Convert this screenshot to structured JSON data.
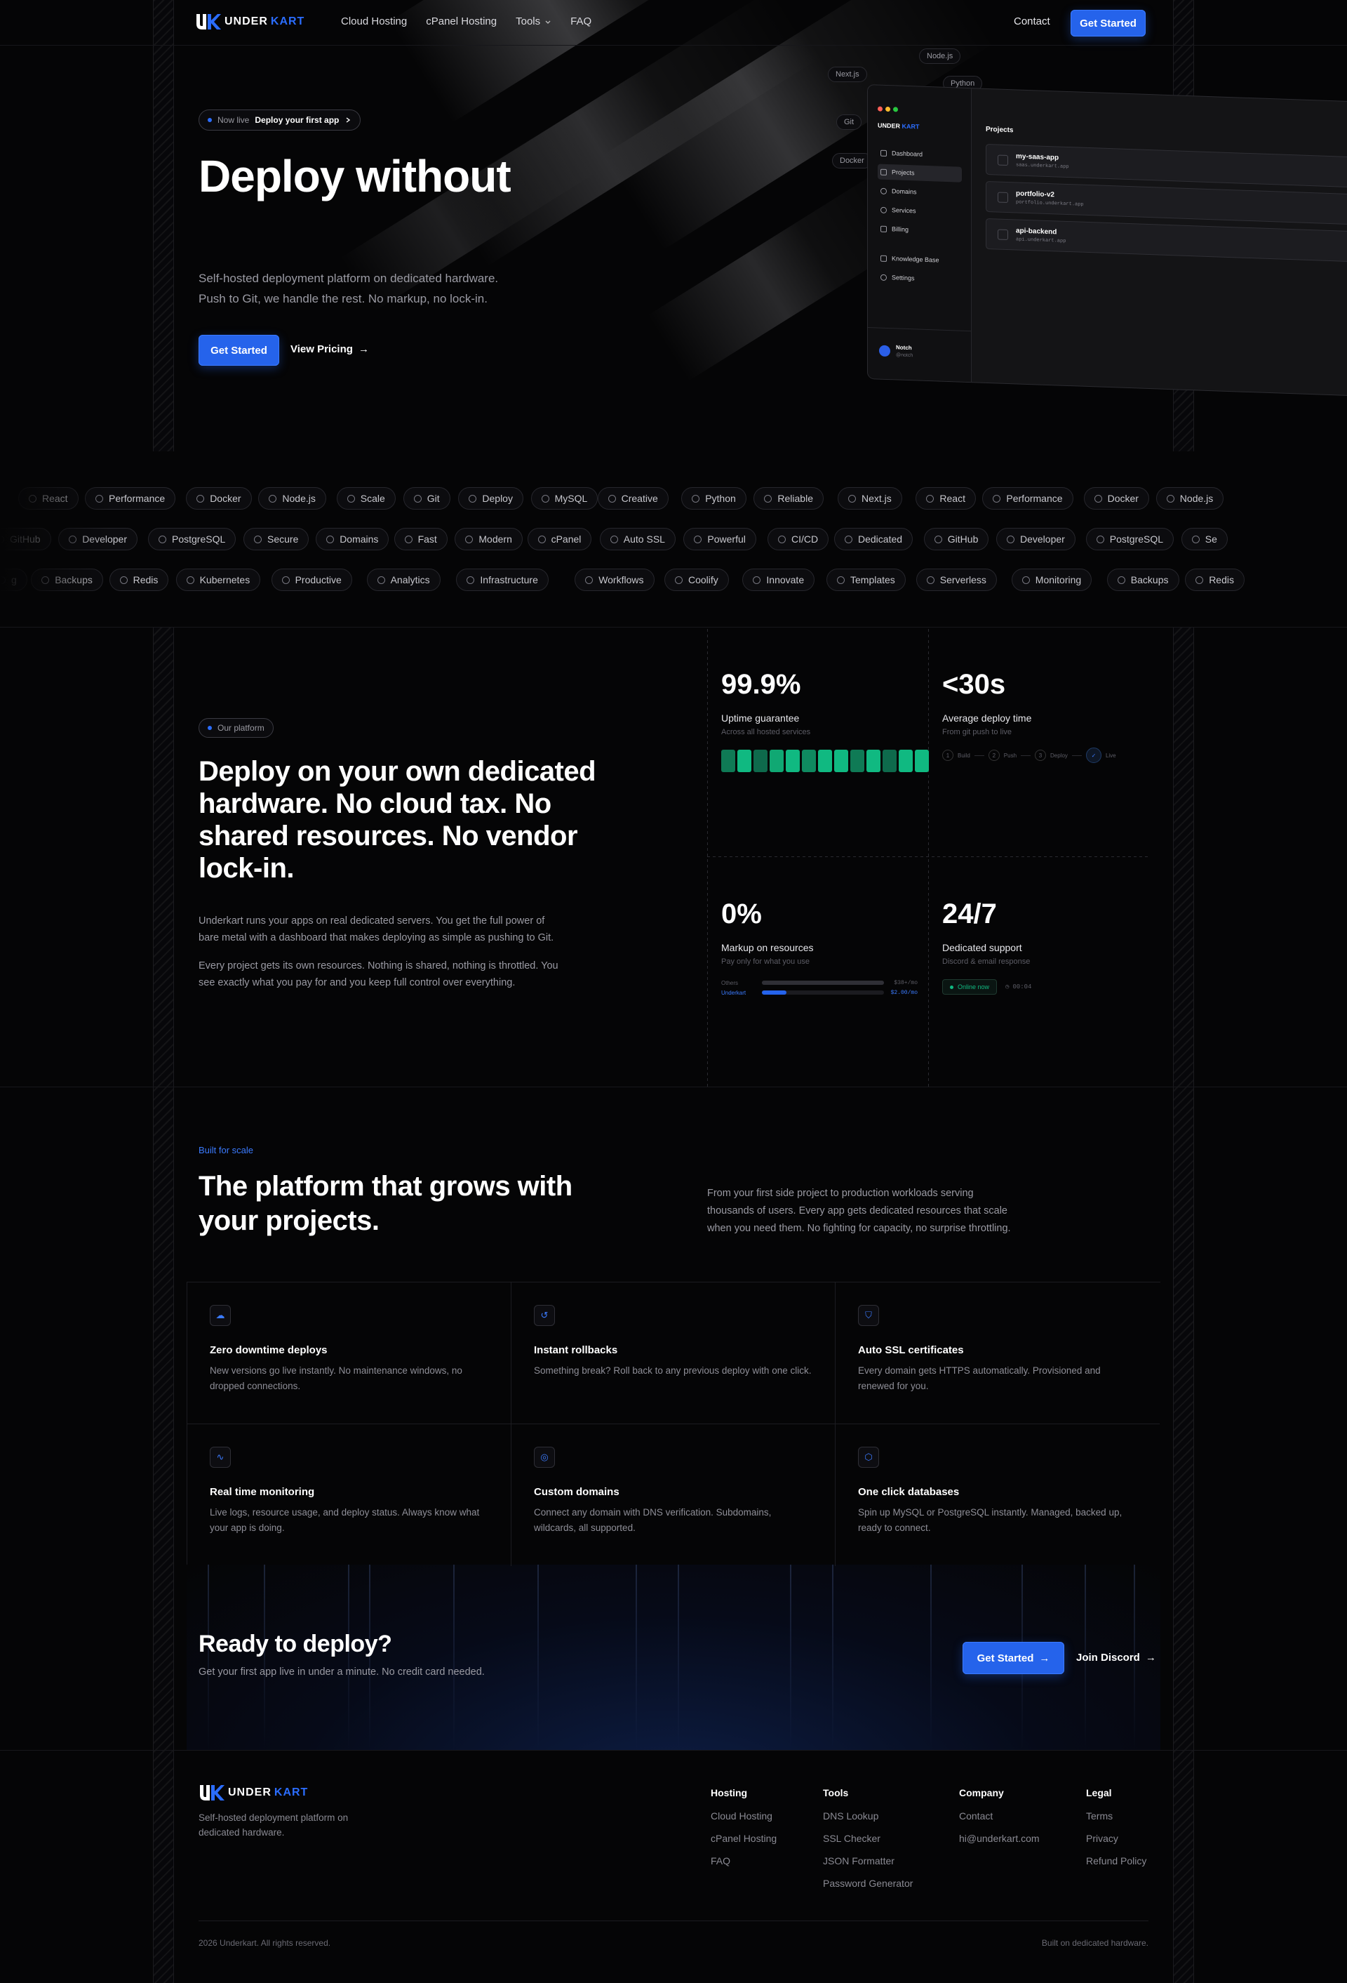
{
  "brand": {
    "name_part1": "UNDER",
    "name_part2": "KART",
    "accent": "#2563eb"
  },
  "nav": {
    "links": [
      "Cloud Hosting",
      "cPanel Hosting",
      "Tools",
      "FAQ"
    ],
    "contact": "Contact",
    "cta": "Get Started"
  },
  "hero": {
    "badge_status": "Now live",
    "badge_text": "Deploy your first app",
    "title": "Deploy without",
    "subtitle_line1": "Self-hosted deployment platform on dedicated hardware.",
    "subtitle_line2": "Push to Git, we handle the rest. No markup, no lock-in.",
    "primary_cta": "Get Started",
    "secondary_cta": "View Pricing",
    "floating_tags": [
      "Node.js",
      "Next.js",
      "Python",
      "Git",
      "Docker"
    ]
  },
  "dashboard": {
    "nav": [
      "Dashboard",
      "Projects",
      "Domains",
      "Services",
      "Billing",
      "Knowledge Base",
      "Settings"
    ],
    "section_title": "Projects",
    "projects": [
      {
        "name": "my-saas-app",
        "url": "saas.underkart.app"
      },
      {
        "name": "portfolio-v2",
        "url": "portfolio.underkart.app"
      },
      {
        "name": "api-backend",
        "url": "api.underkart.app"
      }
    ],
    "user_name": "Notch",
    "user_handle": "@notch"
  },
  "marquee": {
    "row1": [
      "React",
      "Performance",
      "Docker",
      "Node.js",
      "Scale",
      "Git",
      "Deploy",
      "MySQL",
      "Creative",
      "Python",
      "Reliable",
      "Next.js",
      "React",
      "Performance",
      "Docker",
      "Node.js"
    ],
    "row2": [
      "GitHub",
      "Developer",
      "PostgreSQL",
      "Secure",
      "Domains",
      "Fast",
      "Modern",
      "cPanel",
      "Auto SSL",
      "Powerful",
      "CI/CD",
      "Dedicated",
      "GitHub",
      "Developer",
      "PostgreSQL",
      "Se"
    ],
    "row3": [
      "g",
      "Backups",
      "Redis",
      "Kubernetes",
      "Productive",
      "Analytics",
      "Infrastructure",
      "Workflows",
      "Coolify",
      "Innovate",
      "Templates",
      "Serverless",
      "Monitoring",
      "Backups",
      "Redis"
    ]
  },
  "platform": {
    "badge": "Our platform",
    "title_line1": "Deploy on your own dedicated",
    "title_line2": "hardware. No cloud tax. No",
    "title_line3": "shared resources. No vendor",
    "title_line4": "lock-in.",
    "para1_line1": "Underkart runs your apps on real dedicated servers. You get the full power of",
    "para1_line2": "bare metal with a dashboard that makes deploying as simple as pushing to Git.",
    "para2_line1": "Every project gets its own resources. Nothing is shared, nothing is throttled. You",
    "para2_line2": "see exactly what you pay for and you keep full control over everything.",
    "stats": [
      {
        "value": "99.9%",
        "label": "Uptime guarantee",
        "sub": "Across all hosted services"
      },
      {
        "value": "<30s",
        "label": "Average deploy time",
        "sub": "From git push to live"
      },
      {
        "value": "0%",
        "label": "Markup on resources",
        "sub": "Pay only for what you use"
      },
      {
        "value": "24/7",
        "label": "Dedicated support",
        "sub": "Discord & email response"
      }
    ],
    "deploy_steps": [
      {
        "n": "1",
        "label": "Build"
      },
      {
        "n": "2",
        "label": "Push"
      },
      {
        "n": "3",
        "label": "Deploy"
      },
      {
        "n": "✓",
        "label": "Live"
      }
    ],
    "markup_compare": [
      {
        "name": "Others",
        "price": "$38+/mo",
        "fill": 1.0
      },
      {
        "name": "Underkart",
        "price": "$2.00/mo",
        "fill": 0.2
      }
    ],
    "support_status": "Online now",
    "support_time": "00:04",
    "uptime_bar_color": "#10b981"
  },
  "scale": {
    "eyebrow": "Built for scale",
    "title_line1": "The platform that grows with",
    "title_line2": "your projects.",
    "desc_line1": "From your first side project to production workloads serving",
    "desc_line2": "thousands of users. Every app gets dedicated resources that scale",
    "desc_line3": "when you need them. No fighting for capacity, no surprise throttling.",
    "features": [
      {
        "icon": "cloud-upload-icon",
        "title": "Zero downtime deploys",
        "desc": "New versions go live instantly. No maintenance windows, no dropped connections."
      },
      {
        "icon": "rollback-icon",
        "title": "Instant rollbacks",
        "desc": "Something break? Roll back to any previous deploy with one click."
      },
      {
        "icon": "shield-check-icon",
        "title": "Auto SSL certificates",
        "desc": "Every domain gets HTTPS automatically. Provisioned and renewed for you."
      },
      {
        "icon": "activity-icon",
        "title": "Real time monitoring",
        "desc": "Live logs, resource usage, and deploy status. Always know what your app is doing."
      },
      {
        "icon": "globe-icon",
        "title": "Custom domains",
        "desc": "Connect any domain with DNS verification. Subdomains, wildcards, all supported."
      },
      {
        "icon": "database-icon",
        "title": "One click databases",
        "desc": "Spin up MySQL or PostgreSQL instantly. Managed, backed up, ready to connect."
      }
    ]
  },
  "cta": {
    "title": "Ready to deploy?",
    "subtitle": "Get your first app live in under a minute. No credit card needed.",
    "primary": "Get Started",
    "secondary": "Join Discord"
  },
  "footer": {
    "tagline_line1": "Self-hosted deployment platform on",
    "tagline_line2": "dedicated hardware.",
    "columns": [
      {
        "title": "Hosting",
        "links": [
          "Cloud Hosting",
          "cPanel Hosting",
          "FAQ"
        ]
      },
      {
        "title": "Tools",
        "links": [
          "DNS Lookup",
          "SSL Checker",
          "JSON Formatter",
          "Password Generator"
        ]
      },
      {
        "title": "Company",
        "links": [
          "Contact",
          "hi@underkart.com"
        ]
      },
      {
        "title": "Legal",
        "links": [
          "Terms",
          "Privacy",
          "Refund Policy"
        ]
      }
    ],
    "copyright": "2026 Underkart. All rights reserved.",
    "built_on": "Built on dedicated hardware."
  }
}
